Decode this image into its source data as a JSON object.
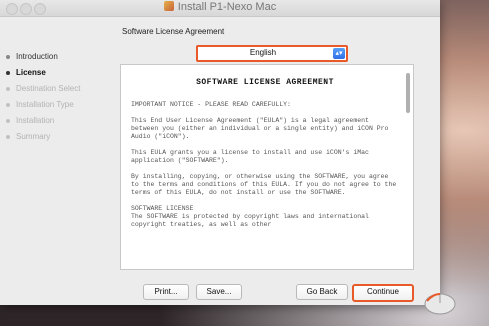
{
  "window": {
    "title": "Install P1-Nexo Mac"
  },
  "sidebar": {
    "items": [
      {
        "label": "Introduction",
        "state": "done"
      },
      {
        "label": "License",
        "state": "active"
      },
      {
        "label": "Destination Select",
        "state": "pending"
      },
      {
        "label": "Installation Type",
        "state": "pending"
      },
      {
        "label": "Installation",
        "state": "pending"
      },
      {
        "label": "Summary",
        "state": "pending"
      }
    ]
  },
  "main": {
    "title": "Software License Agreement",
    "language": {
      "selected": "English"
    },
    "document": {
      "heading": "SOFTWARE LICENSE AGREEMENT",
      "paragraphs": [
        "IMPORTANT NOTICE - PLEASE READ CAREFULLY:",
        "This End User License Agreement (\"EULA\") is a legal agreement between you (either an individual or a single entity) and iCON Pro Audio (\"iCON\").",
        "This EULA grants you a license to install and use iCON's iMac application (\"SOFTWARE\").",
        "By installing, copying, or otherwise using the SOFTWARE, you agree to the terms and conditions of this EULA. If you do not agree to the terms of this EULA, do not install or use the SOFTWARE.",
        "SOFTWARE LICENSE\nThe SOFTWARE is protected by copyright laws and international copyright treaties, as well as other"
      ]
    }
  },
  "footer": {
    "print_label": "Print...",
    "save_label": "Save...",
    "go_back_label": "Go Back",
    "continue_label": "Continue"
  },
  "colors": {
    "highlight": "#e85a2a",
    "select_accent": "#2d6ee8"
  }
}
